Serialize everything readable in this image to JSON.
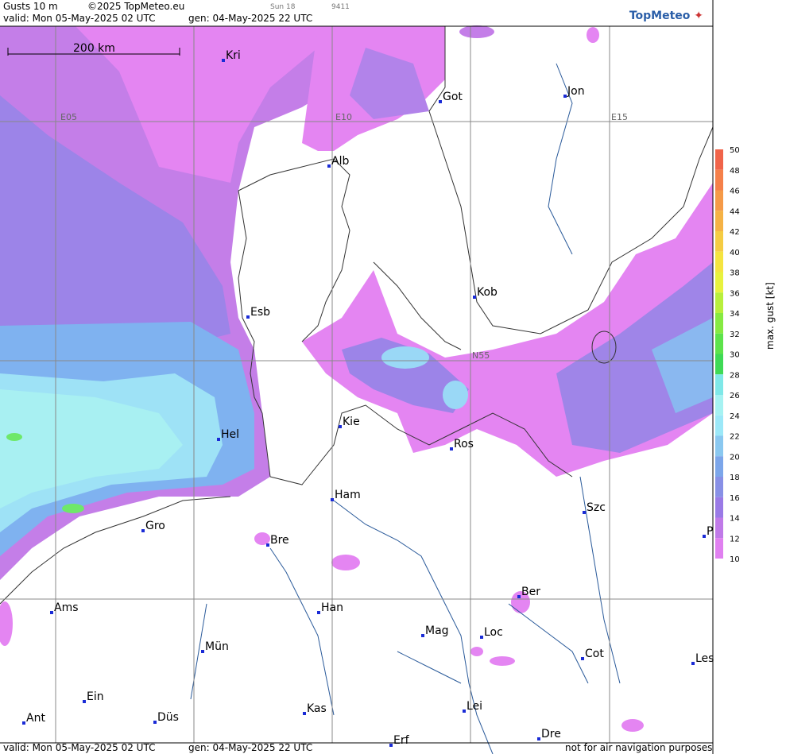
{
  "header": {
    "title": "Gusts 10 m",
    "copyright": "©2025 TopMeteo.eu",
    "sun": "Sun 18",
    "id": "9411",
    "valid": "valid:  Mon  05-May-2025  02 UTC",
    "gen": "gen: 04-May-2025 22 UTC"
  },
  "footer": {
    "valid": "valid:  Mon  05-May-2025  02 UTC",
    "gen": "gen: 04-May-2025 22 UTC",
    "note": "not for air navigation purposes"
  },
  "logo": "TopMeteo",
  "scale_bar": "200 km",
  "grid_labels": [
    "E05",
    "E10",
    "E15",
    "N55"
  ],
  "legend": {
    "title": "max. gust [kt]",
    "ticks": [
      "50",
      "48",
      "46",
      "44",
      "42",
      "40",
      "38",
      "36",
      "34",
      "32",
      "30",
      "28",
      "26",
      "24",
      "22",
      "20",
      "18",
      "16",
      "14",
      "12",
      "10"
    ],
    "colors": [
      "#f0644a",
      "#f5804a",
      "#f59a48",
      "#f5b245",
      "#f5cc43",
      "#f5e440",
      "#e8f23e",
      "#b8ef3c",
      "#86ea42",
      "#5de34b",
      "#3fda55",
      "#7fe8e8",
      "#a6f2f2",
      "#9ce8f8",
      "#8ac8f0",
      "#7ca6ea",
      "#8890e6",
      "#9a7ae6",
      "#c07ae8",
      "#e080f0",
      "#ffffff"
    ]
  },
  "cities": [
    {
      "name": "Kri"
    },
    {
      "name": "Got"
    },
    {
      "name": "Jon"
    },
    {
      "name": "Alb"
    },
    {
      "name": "Kob"
    },
    {
      "name": "Esb"
    },
    {
      "name": "Kie"
    },
    {
      "name": "Hel"
    },
    {
      "name": "Ros"
    },
    {
      "name": "Ham"
    },
    {
      "name": "Szc"
    },
    {
      "name": "Gro"
    },
    {
      "name": "Bre"
    },
    {
      "name": "P"
    },
    {
      "name": "Ber"
    },
    {
      "name": "Ams"
    },
    {
      "name": "Han"
    },
    {
      "name": "Mag"
    },
    {
      "name": "Loc"
    },
    {
      "name": "Mün"
    },
    {
      "name": "Cot"
    },
    {
      "name": "Les"
    },
    {
      "name": "Ein"
    },
    {
      "name": "Lei"
    },
    {
      "name": "Kas"
    },
    {
      "name": "Ant"
    },
    {
      "name": "Düs"
    },
    {
      "name": "Dre"
    },
    {
      "name": "Erf"
    }
  ]
}
